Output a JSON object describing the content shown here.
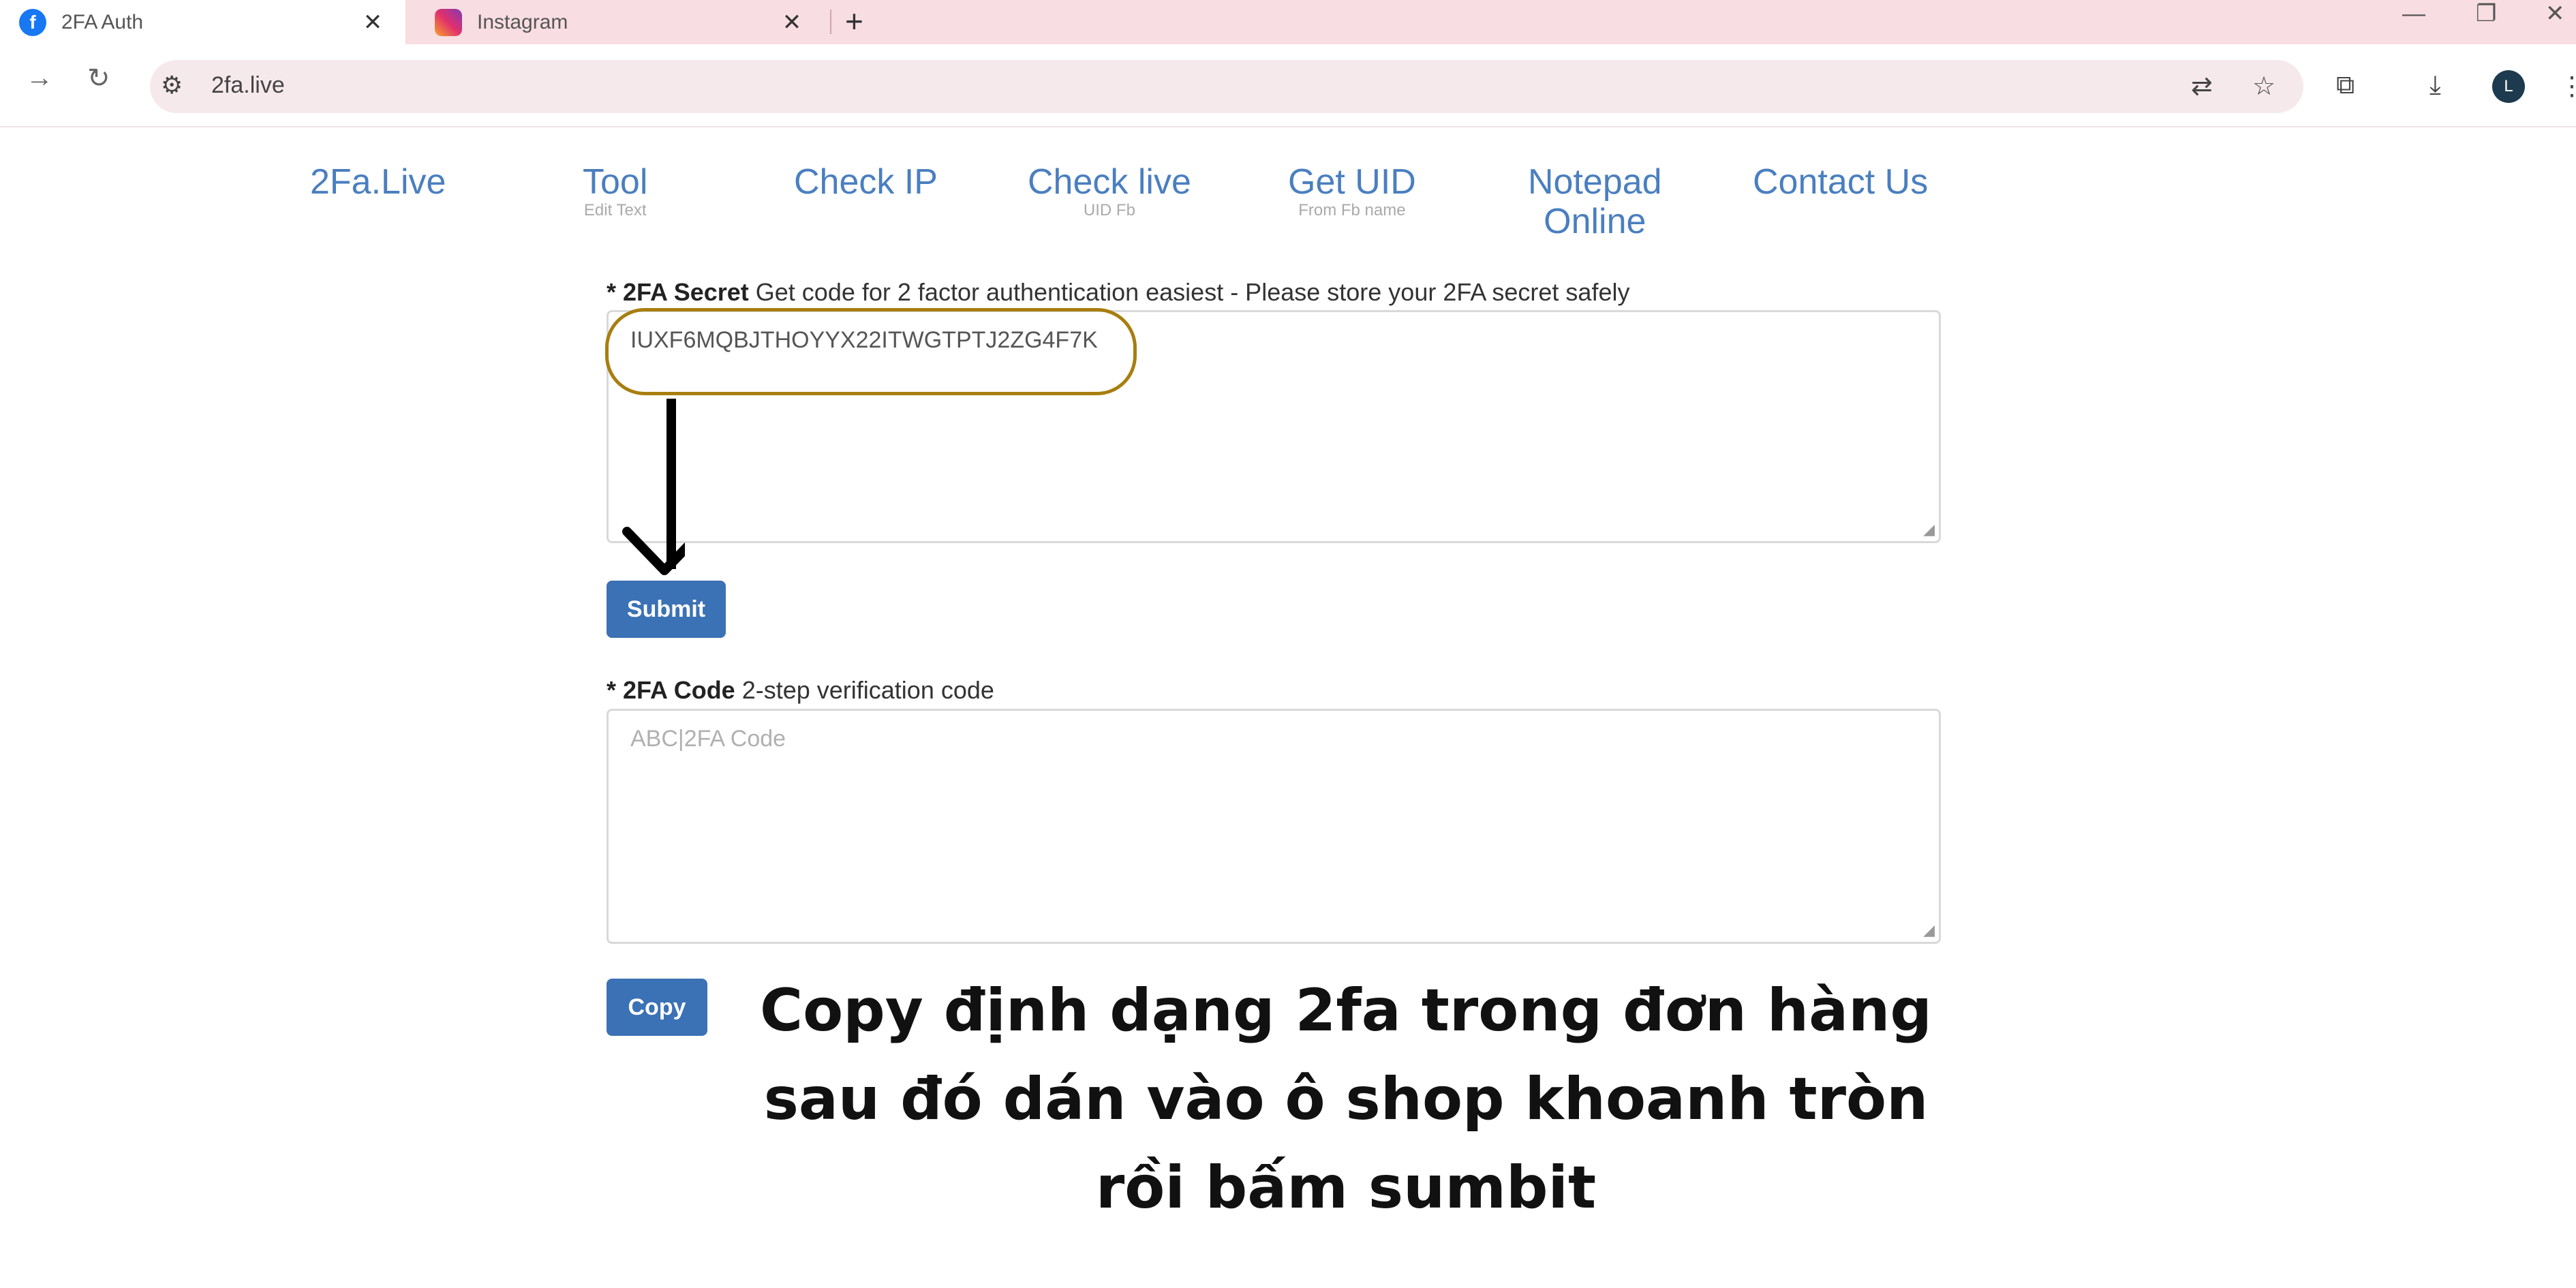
{
  "browser": {
    "tabs": [
      {
        "title": "2FA Auth",
        "icon": "facebook-icon",
        "active": true
      },
      {
        "title": "Instagram",
        "icon": "instagram-icon",
        "active": false
      }
    ],
    "new_tab": "+",
    "url": "2fa.live"
  },
  "nav": {
    "items": [
      {
        "label": "2Fa.Live",
        "sub": ""
      },
      {
        "label": "Tool",
        "sub": "Edit Text"
      },
      {
        "label": "Check IP",
        "sub": ""
      },
      {
        "label": "Check live",
        "sub": "UID Fb"
      },
      {
        "label": "Get UID",
        "sub": "From Fb name"
      },
      {
        "label": "Notepad",
        "label2": "Online",
        "sub": ""
      },
      {
        "label": "Contact Us",
        "sub": ""
      }
    ]
  },
  "secret": {
    "label_bold": "* 2FA Secret",
    "label_rest": " Get code for 2 factor authentication easiest - Please store your 2FA secret safely",
    "value": "IUXF6MQBJTHOYYX22ITWGTPTJ2ZG4F7K",
    "submit_label": "Submit"
  },
  "code": {
    "label_bold": "* 2FA Code",
    "label_rest": " 2-step verification code",
    "placeholder": "ABC|2FA Code",
    "copy_label": "Copy"
  },
  "instruction": {
    "line1": "Copy định dạng 2fa trong đơn hàng",
    "line2": "sau đó dán vào ô shop khoanh tròn",
    "line3": "rồi bấm sumbit"
  },
  "colors": {
    "accent": "#3b71b5",
    "nav_link": "#4a7fc0",
    "highlight": "#a87e10",
    "tabbar": "#f8dde2"
  }
}
